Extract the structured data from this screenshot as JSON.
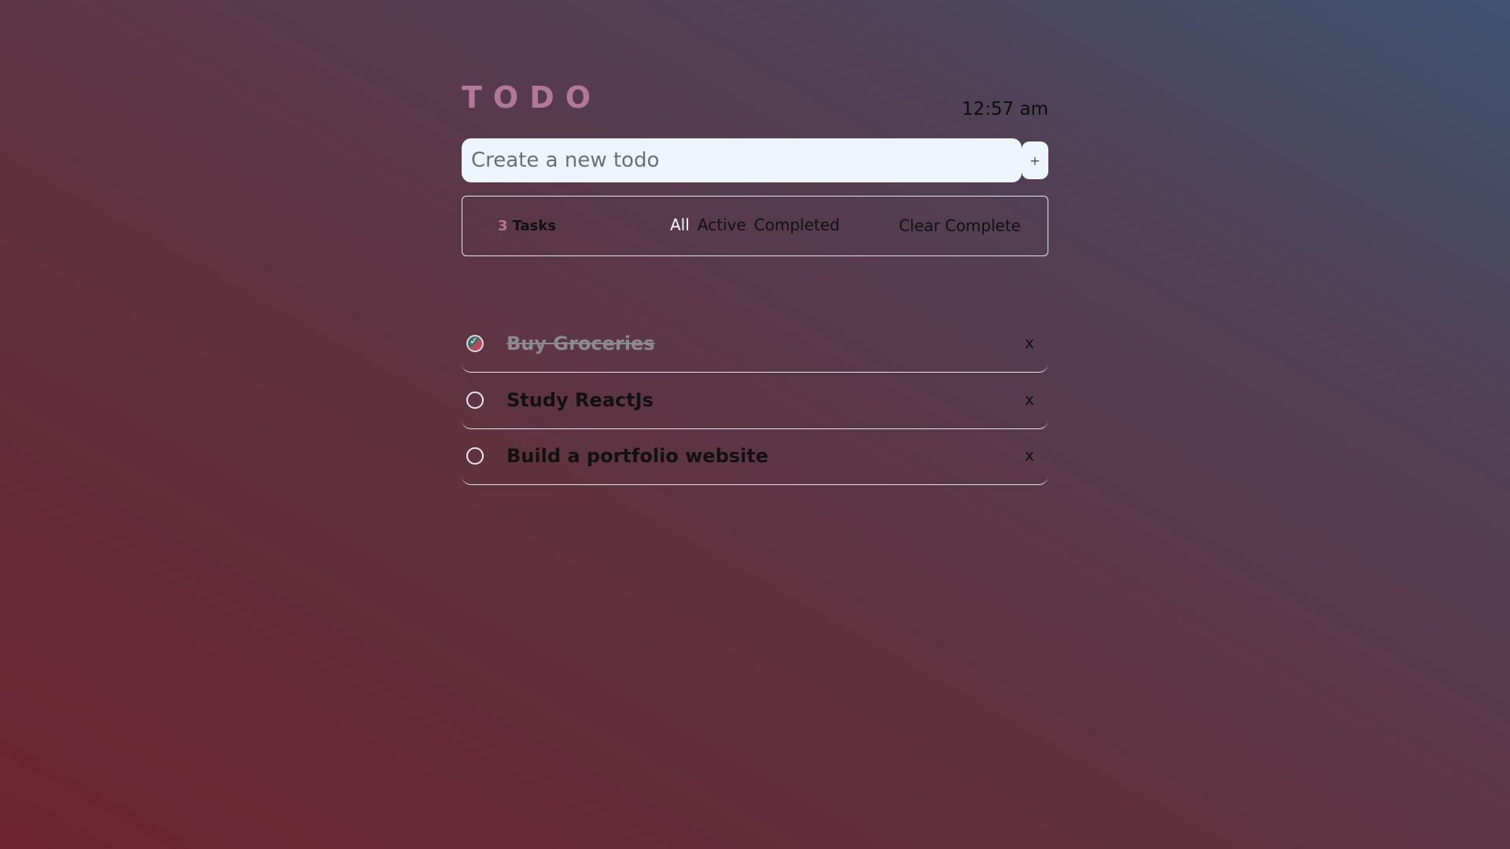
{
  "header": {
    "title": "TODO",
    "time": "12:57 am"
  },
  "new_todo": {
    "placeholder": "Create a new todo",
    "value": "",
    "add_label": "+"
  },
  "filter_bar": {
    "task_count": "3",
    "task_label": "Tasks",
    "filters": [
      {
        "label": "All",
        "active": true
      },
      {
        "label": "Active",
        "active": false
      },
      {
        "label": "Completed",
        "active": false
      }
    ],
    "clear_label": "Clear Complete"
  },
  "todos": [
    {
      "text": "Buy Groceries",
      "completed": true,
      "delete_label": "x",
      "check_mark": "✓"
    },
    {
      "text": "Study ReactJs",
      "completed": false,
      "delete_label": "x"
    },
    {
      "text": "Build a portfolio website",
      "completed": false,
      "delete_label": "x"
    }
  ],
  "colors": {
    "accent": "#b07a97",
    "input_bg": "#eef5ff",
    "border": "#e6e6ee"
  }
}
